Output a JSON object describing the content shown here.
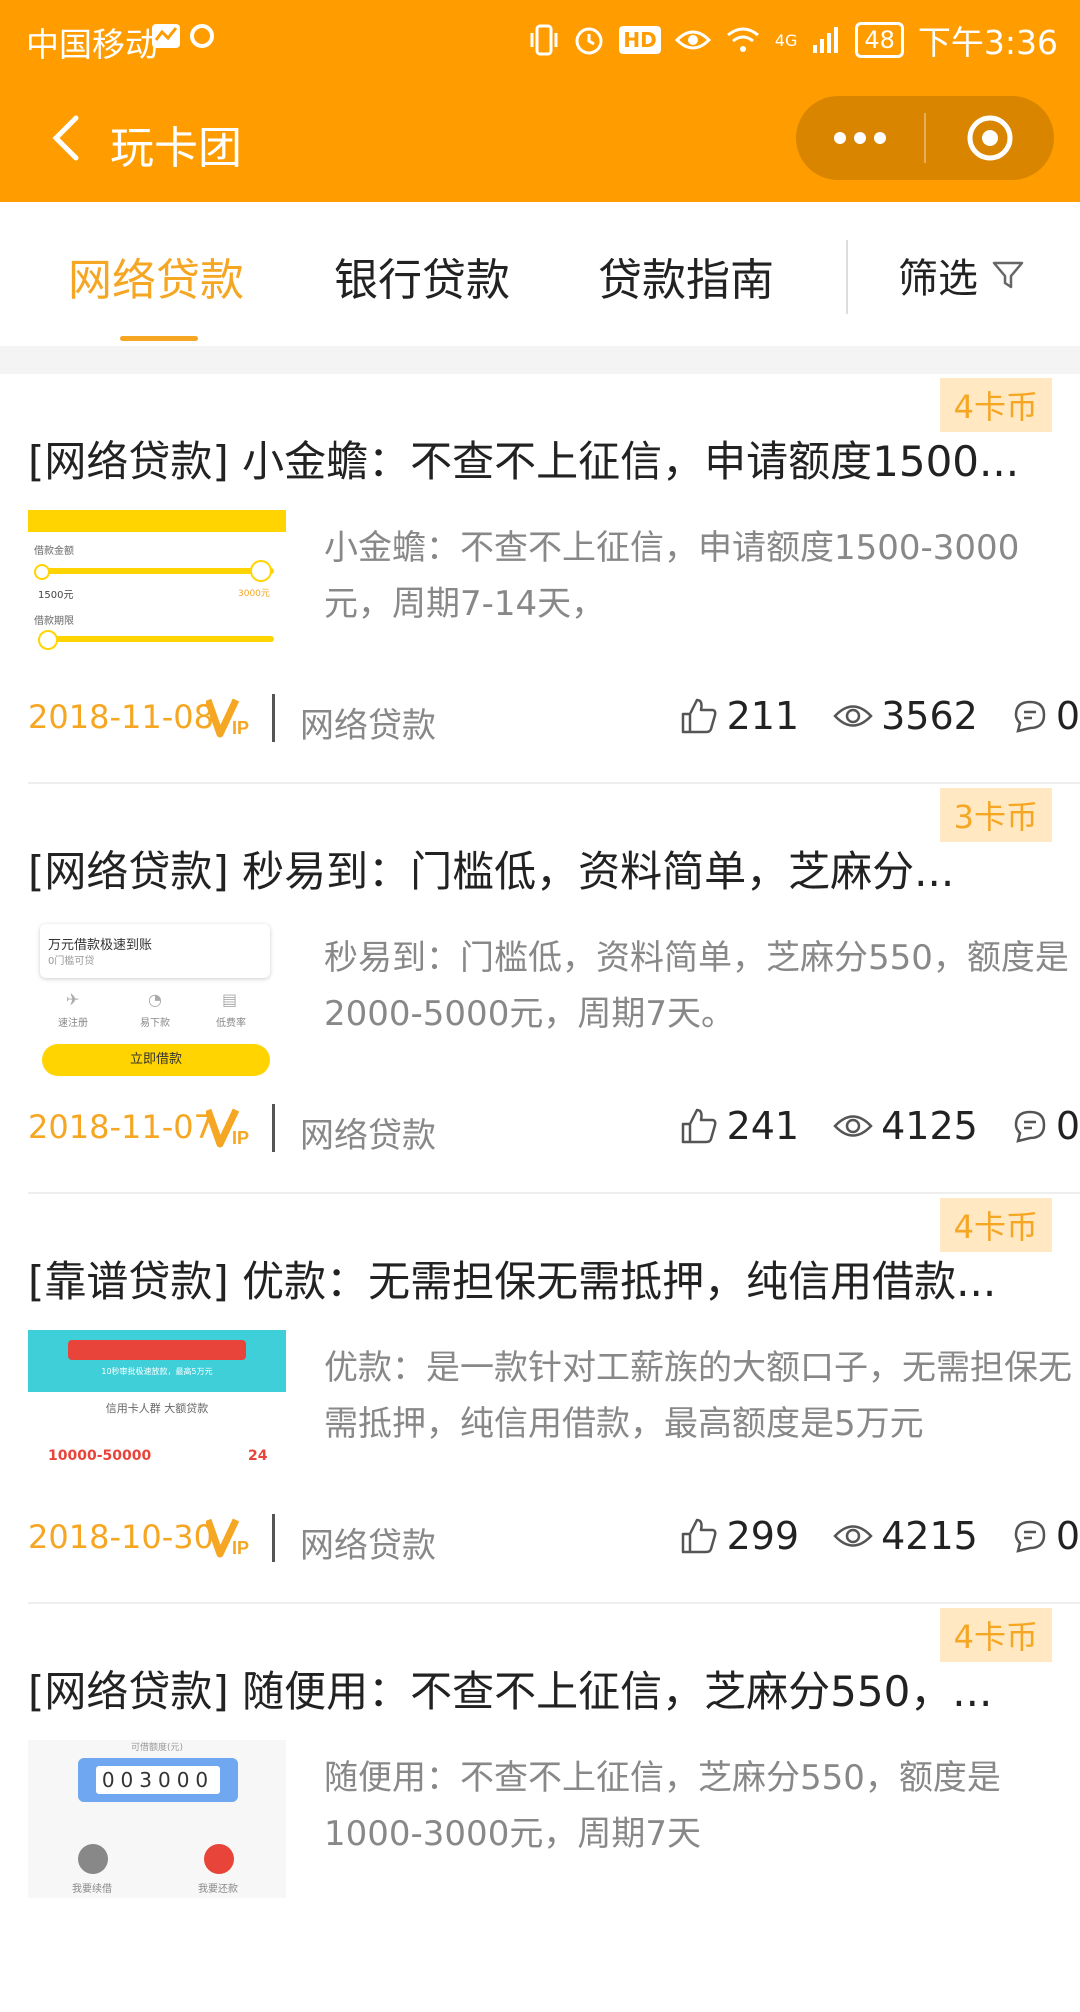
{
  "status_bar": {
    "carrier": "中国移动",
    "time": "下午3:36",
    "battery": "48",
    "network": "4G"
  },
  "nav": {
    "title": "玩卡团",
    "back_icon": "back-arrow-icon",
    "more_icon": "more-dots-icon",
    "close_icon": "target-circle-icon"
  },
  "tabs": {
    "items": [
      "网络贷款",
      "银行贷款",
      "贷款指南"
    ],
    "active": "网络贷款",
    "filter_label": "筛选"
  },
  "colors": {
    "brand": "#FF9C00",
    "accent": "#F5A623",
    "coin_bg": "#FFE8C2"
  },
  "cards": [
    {
      "coin": "4卡币",
      "title": "[网络贷款] 小金蟾：不查不上征信，申请额度1500...",
      "desc": "小金蟾：不查不上征信，申请额度1500-3000元，周期7-14天，",
      "date": "2018-11-08",
      "category": "网络贷款",
      "likes": "211",
      "views": "3562",
      "comments": "0",
      "thumb": {
        "label1": "借款金额",
        "amount": "1500元",
        "max": "3000元",
        "label2": "借款期限"
      }
    },
    {
      "coin": "3卡币",
      "title": "[网络贷款] 秒易到：门槛低，资料简单，芝麻分...",
      "desc": "秒易到：门槛低，资料简单，芝麻分550，额度是2000-5000元，周期7天。",
      "date": "2018-11-07",
      "category": "网络贷款",
      "likes": "241",
      "views": "4125",
      "comments": "0",
      "thumb": {
        "headline": "万元借款极速到账",
        "sub": "0门槛可贷",
        "f1": "速注册",
        "f2": "易下款",
        "f3": "低费率",
        "button": "立即借款"
      }
    },
    {
      "coin": "4卡币",
      "title": "[靠谱贷款] 优款：无需担保无需抵押，纯信用借款...",
      "desc": "优款：是一款针对工薪族的大额口子，无需担保无需抵押，纯信用借款，最高额度是5万元",
      "date": "2018-10-30",
      "category": "网络贷款",
      "likes": "299",
      "views": "4215",
      "comments": "0",
      "thumb": {
        "banner": "10秒审批极速放款，最高5万元",
        "caption": "信用卡人群 大额贷款",
        "range": "10000-50000",
        "num": "24"
      }
    },
    {
      "coin": "4卡币",
      "title": "[网络贷款] 随便用：不查不上征信，芝麻分550，...",
      "desc": "随便用：不查不上征信，芝麻分550，额度是1000-3000元，周期7天",
      "date": "",
      "category": "",
      "likes": "",
      "views": "",
      "comments": "",
      "thumb": {
        "top": "可借额度(元)",
        "digits": "003000",
        "b1": "我要续借",
        "b2": "我要还款"
      }
    }
  ]
}
